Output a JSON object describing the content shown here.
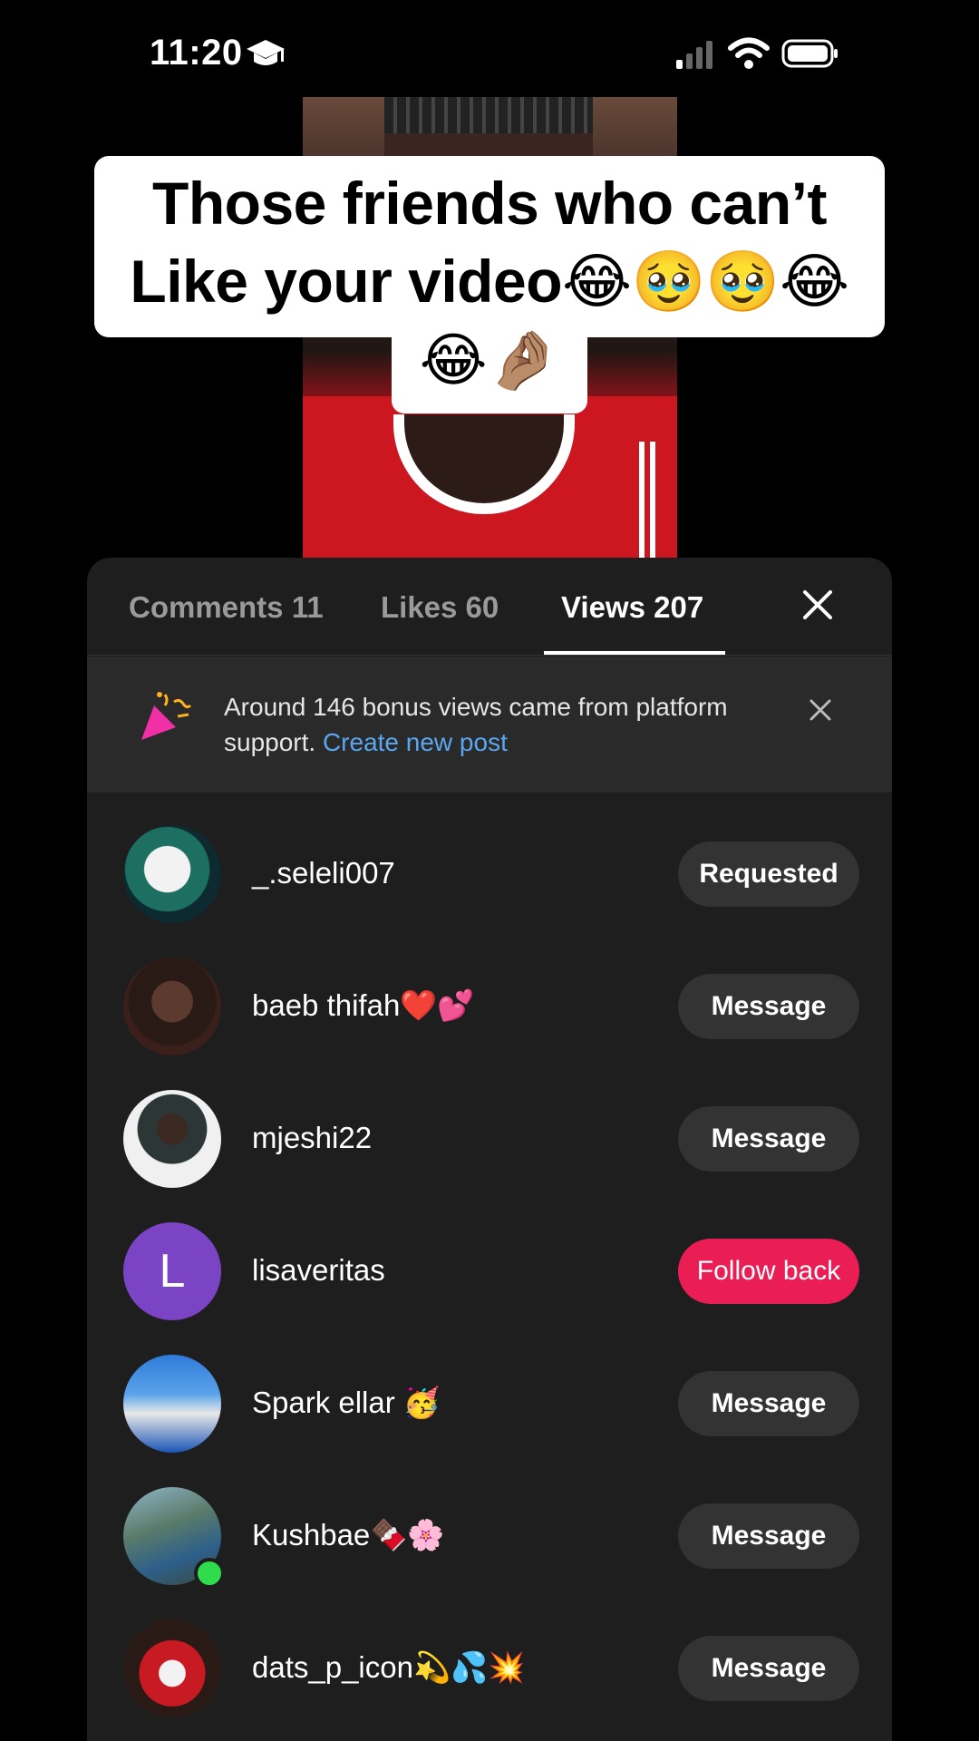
{
  "status_bar": {
    "time": "11:20",
    "icons": [
      "graduation-cap-icon",
      "signal-icon",
      "wifi-icon",
      "battery-icon"
    ]
  },
  "video": {
    "caption_line1": "Those friends who can’t",
    "caption_line2": "Like your video😂🥹🥹😂",
    "caption_line3": "😂🤌🏽"
  },
  "tabs": {
    "comments": "Comments 11",
    "likes": "Likes 60",
    "views": "Views 207",
    "active": "views"
  },
  "notice": {
    "text": "Around 146 bonus views came from platform support.",
    "link": "Create new post"
  },
  "viewers": [
    {
      "name": "_.seleli007",
      "action": "Requested"
    },
    {
      "name": "baeb thifah❤️💕",
      "action": "Message"
    },
    {
      "name": "mjeshi22",
      "action": "Message"
    },
    {
      "name": "lisaveritas",
      "action": "Follow back",
      "avatar_letter": "L"
    },
    {
      "name": "Spark ellar 🥳",
      "action": "Message"
    },
    {
      "name": "Kushbae🍫🌸",
      "action": "Message"
    },
    {
      "name": "dats_p_icon💫💦💥",
      "action": "Message"
    }
  ],
  "colors": {
    "sheet_bg": "#1e1e1e",
    "notice_bg": "#2a2a2a",
    "link": "#5aa7f0",
    "follow_back": "#ea1e55",
    "online": "#2fdc4d"
  }
}
